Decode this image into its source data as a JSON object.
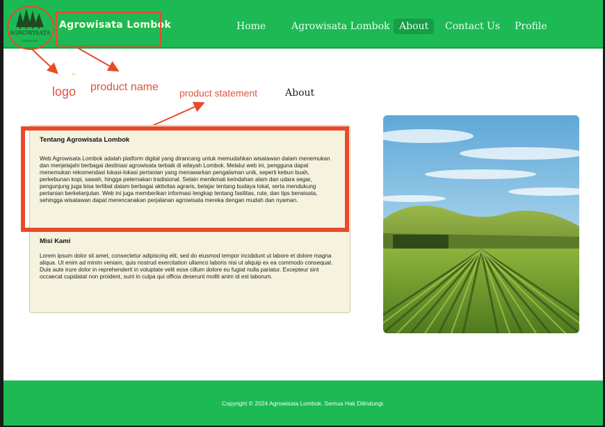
{
  "header": {
    "logo_text": "AGROWISATA",
    "logo_sub": "LOMBOK",
    "brand": "Agrowisata Lombok",
    "nav": [
      "Home",
      "Agrowisata Lombok",
      "About",
      "Contact Us",
      "Profile"
    ],
    "active_nav": "About"
  },
  "annotations": {
    "logo": "logo",
    "product_name": "product name",
    "product_statement": "product statement"
  },
  "main": {
    "section_heading": "About",
    "card": {
      "heading1": "Tentang Agrowisata Lombok",
      "para1": "Web Agrowisata Lombok adalah platform digital yang dirancang untuk memudahkan wisatawan dalam menemukan dan menjelajahi berbagai destinasi agrowisata terbaik di wilayah Lombok. Melalui web ini, pengguna dapat menemukan rekomendasi lokasi-lokasi pertanian yang menawarkan pengalaman unik, seperti kebun buah, perkebunan kopi, sawah, hingga peternakan tradisional. Selain menikmati keindahan alam dan udara segar, pengunjung juga bisa terlibat dalam berbagai aktivitas agraris, belajar tentang budaya lokal, serta mendukung pertanian berkelanjutan. Web ini juga memberikan informasi lengkap tentang fasilitas, rute, dan tips berwisata, sehingga wisatawan dapat merencanakan perjalanan agrowisata mereka dengan mudah dan nyaman.",
      "heading2": "Misi Kami",
      "para2": "Lorem ipsum dolor sit amet, consectetur adipiscing elit, sed do eiusmod tempor incididunt ut labore et dolore magna aliqua. Ut enim ad minim veniam, quis nostrud exercitation ullamco laboris nisi ut aliquip ex ea commodo consequat. Duis aute irure dolor in reprehenderit in voluptate velit esse cillum dolore eu fugiat nulla pariatur. Excepteur sint occaecat cupidatat non proident, sunt in culpa qui officia deserunt mollit anim id est laborum."
    }
  },
  "footer": {
    "copyright": "Copyright © 2024 Agrowisata Lombok. Semua Hak Dilindungi."
  },
  "colors": {
    "primary_green": "#1db954",
    "card_bg": "#f5f2de",
    "annotation_red": "#e84a2a"
  }
}
